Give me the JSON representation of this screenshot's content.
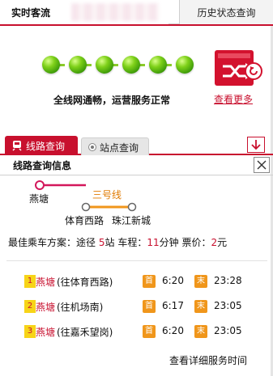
{
  "header": {
    "tab_live": "实时客流",
    "tab_history": "历史状态查询"
  },
  "status": {
    "dot_count": 6,
    "dot_color": "#7fd11a",
    "message": "全线网通畅，运营服务正常",
    "more_link": "查看更多"
  },
  "query_tabs": {
    "route": "线路查询",
    "station": "站点查询"
  },
  "panel": {
    "title": "线路查询信息",
    "origin": "燕塘",
    "line_name": "三号线",
    "transfer_from": "体育西路",
    "destination": "珠江新城",
    "plan": {
      "label": "最佳乘车方案：途径",
      "stations": "5",
      "stations_unit": "站",
      "time_label": "车程：",
      "minutes": "11",
      "minutes_unit": "分钟",
      "fare_label": "票价：",
      "fare": "2",
      "fare_unit": "元"
    },
    "rows": [
      {
        "n": "1",
        "station": "燕塘",
        "dir": "(往体育西路)",
        "first_label": "首",
        "first": "6:20",
        "last_label": "末",
        "last": "23:28"
      },
      {
        "n": "2",
        "station": "燕塘",
        "dir": "(往机场南)",
        "first_label": "首",
        "first": "6:17",
        "last_label": "末",
        "last": "23:05"
      },
      {
        "n": "3",
        "station": "燕塘",
        "dir": "(往嘉禾望岗)",
        "first_label": "首",
        "first": "6:20",
        "last_label": "末",
        "last": "23:05"
      }
    ],
    "detail_link": "查看详细服务时间"
  },
  "colors": {
    "accent_red": "#c8102e",
    "line3_orange": "#f0961b",
    "origin_line_pink": "#d3175b"
  }
}
